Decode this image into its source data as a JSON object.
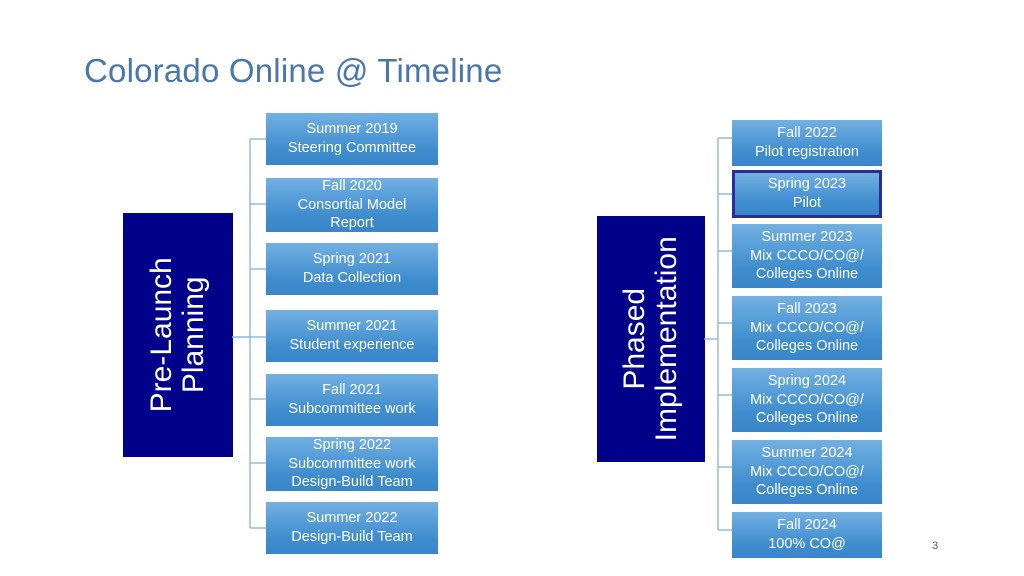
{
  "slide": {
    "title": "Colorado Online @ Timeline",
    "page_number": "3",
    "accent_title_color": "#4a77ab",
    "stage_box_color": "#010189",
    "milestone_color": "#3e8ccd",
    "highlight_border_color": "#2b2b9b",
    "connector_color": "#8fb8d4"
  },
  "branches": [
    {
      "id": "pre-launch-planning",
      "stage_label_line1": "Pre-Launch",
      "stage_label_line2": "Planning",
      "milestones": [
        {
          "id": "summer-2019",
          "highlight": false,
          "lines": [
            "Summer 2019",
            "Steering Committee"
          ]
        },
        {
          "id": "fall-2020",
          "highlight": false,
          "lines": [
            "Fall 2020",
            "Consortial Model",
            "Report"
          ]
        },
        {
          "id": "spring-2021",
          "highlight": false,
          "lines": [
            "Spring 2021",
            "Data Collection"
          ]
        },
        {
          "id": "summer-2021",
          "highlight": false,
          "lines": [
            "Summer 2021",
            "Student experience"
          ]
        },
        {
          "id": "fall-2021",
          "highlight": false,
          "lines": [
            "Fall 2021",
            "Subcommittee work"
          ]
        },
        {
          "id": "spring-2022",
          "highlight": false,
          "lines": [
            "Spring 2022",
            "Subcommittee work",
            "Design-Build Team"
          ]
        },
        {
          "id": "summer-2022",
          "highlight": false,
          "lines": [
            "Summer 2022",
            "Design-Build Team"
          ]
        }
      ]
    },
    {
      "id": "phased-implementation",
      "stage_label_line1": "Phased",
      "stage_label_line2": "Implementation",
      "milestones": [
        {
          "id": "fall-2022",
          "highlight": false,
          "lines": [
            "Fall 2022",
            "Pilot registration"
          ]
        },
        {
          "id": "spring-2023",
          "highlight": true,
          "lines": [
            "Spring 2023",
            "Pilot"
          ]
        },
        {
          "id": "summer-2023",
          "highlight": false,
          "lines": [
            "Summer 2023",
            "Mix CCCO/CO@/",
            "Colleges Online"
          ]
        },
        {
          "id": "fall-2023",
          "highlight": false,
          "lines": [
            "Fall 2023",
            "Mix CCCO/CO@/",
            "Colleges Online"
          ]
        },
        {
          "id": "spring-2024",
          "highlight": false,
          "lines": [
            "Spring 2024",
            "Mix CCCO/CO@/",
            "Colleges Online"
          ]
        },
        {
          "id": "summer-2024",
          "highlight": false,
          "lines": [
            "Summer 2024",
            "Mix CCCO/CO@/",
            "Colleges Online"
          ]
        },
        {
          "id": "fall-2024",
          "highlight": false,
          "lines": [
            "Fall 2024",
            "100% CO@"
          ]
        }
      ]
    }
  ]
}
